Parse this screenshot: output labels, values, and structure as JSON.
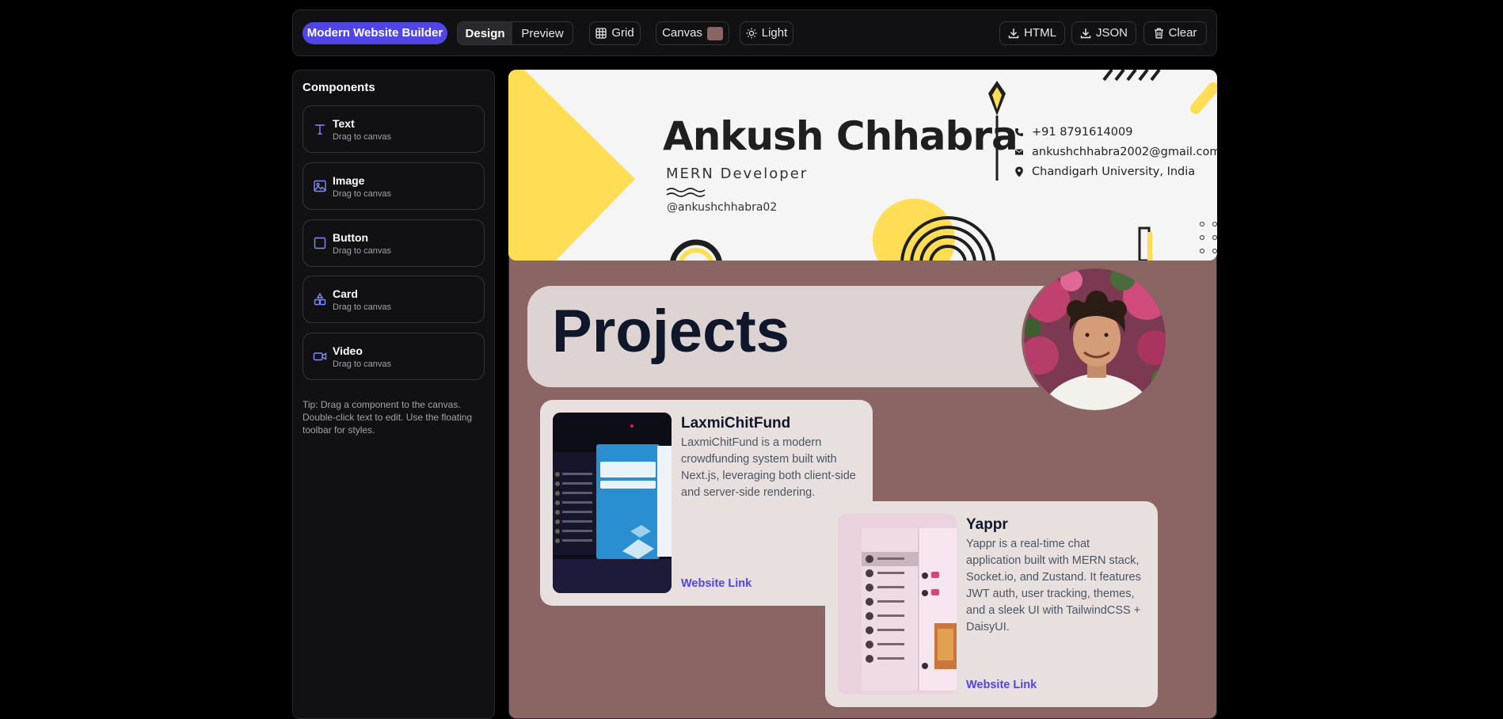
{
  "toolbar": {
    "brand": "Modern Website Builder",
    "mode_design": "Design",
    "mode_preview": "Preview",
    "grid": "Grid",
    "canvas": "Canvas",
    "canvas_color": "#8b6464",
    "theme": "Light",
    "export_html": "HTML",
    "export_json": "JSON",
    "clear": "Clear"
  },
  "sidebar": {
    "title": "Components",
    "items": [
      {
        "label": "Text",
        "hint": "Drag to canvas",
        "icon": "text-icon"
      },
      {
        "label": "Image",
        "hint": "Drag to canvas",
        "icon": "image-icon"
      },
      {
        "label": "Button",
        "hint": "Drag to canvas",
        "icon": "square-icon"
      },
      {
        "label": "Card",
        "hint": "Drag to canvas",
        "icon": "shapes-icon"
      },
      {
        "label": "Video",
        "hint": "Drag to canvas",
        "icon": "video-icon"
      }
    ],
    "tip": "Tip: Drag a component to the canvas. Double-click text to edit. Use the floating toolbar for styles."
  },
  "banner": {
    "name": "Ankush Chhabra",
    "role": "MERN Developer",
    "handle": "@ankushchhabra02",
    "phone": "+91 8791614009",
    "email": "ankushchhabra2002@gmail.com",
    "location": "Chandigarh University, India"
  },
  "projects": {
    "title": "Projects",
    "cards": [
      {
        "title": "LaxmiChitFund",
        "description": "LaxmiChitFund is a modern crowdfunding system built with Next.js, leveraging both client-side and server-side rendering.",
        "link": "Website Link"
      },
      {
        "title": "Yappr",
        "description": "Yappr is a real-time chat application built with MERN stack, Socket.io, and Zustand. It features JWT auth, user tracking, themes, and a sleek UI with TailwindCSS + DaisyUI.",
        "link": "Website Link"
      }
    ]
  }
}
